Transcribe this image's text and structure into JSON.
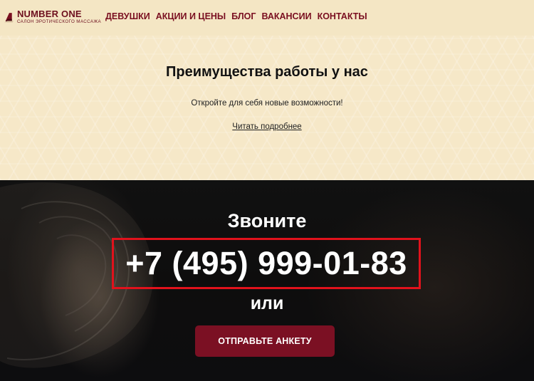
{
  "header": {
    "logo": {
      "title": "NUMBER ONE",
      "subtitle": "САЛОН ЭРОТИЧЕСКОГО МАССАЖА"
    },
    "nav": [
      {
        "label": "ДЕВУШКИ"
      },
      {
        "label": "АКЦИИ И ЦЕНЫ"
      },
      {
        "label": "БЛОГ"
      },
      {
        "label": "ВАКАНСИИ"
      },
      {
        "label": "КОНТАКТЫ"
      }
    ]
  },
  "benefits": {
    "title": "Преимущества работы у нас",
    "subtitle": "Откройте для себя новые возможности!",
    "link": "Читать подробнее"
  },
  "call": {
    "title": "Звоните",
    "phone": "+7 (495) 999-01-83",
    "or": "или",
    "button": "ОТПРАВЬТЕ АНКЕТУ"
  },
  "colors": {
    "header_bg": "#f4e6c4",
    "brand": "#7a0f20",
    "phone_highlight": "#e1121c",
    "button_bg": "#7b1023"
  }
}
